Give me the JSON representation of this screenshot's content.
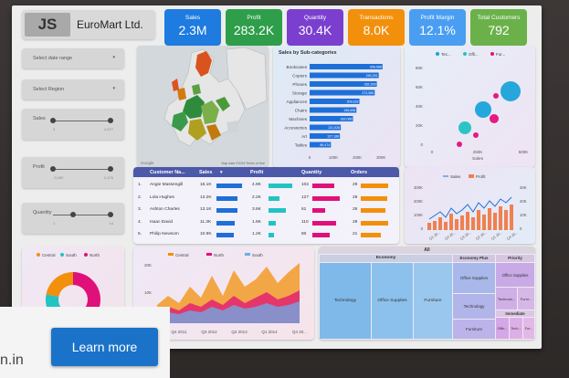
{
  "brand": {
    "logo_text": "JS",
    "name": "EuroMart Ltd."
  },
  "kpis": [
    {
      "title": "Sales",
      "value": "2.3M",
      "color": "#1e7be0"
    },
    {
      "title": "Profit",
      "value": "283.2K",
      "color": "#2e9e4a"
    },
    {
      "title": "Quantity",
      "value": "30.4K",
      "color": "#7b3fcf"
    },
    {
      "title": "Transactions",
      "value": "8.0K",
      "color": "#f2900c"
    },
    {
      "title": "Profit Margin",
      "value": "12.1%",
      "color": "#4a9ef2"
    },
    {
      "title": "Total Customers",
      "value": "792",
      "color": "#6bb14a"
    }
  ],
  "filters": {
    "date_range": "Select date range",
    "region": "Select Region",
    "sales": {
      "label": "Sales",
      "min": "3",
      "max": "4,677"
    },
    "profit": {
      "label": "Profit",
      "min": "-3,060",
      "max": "2,476"
    },
    "quantity": {
      "label": "Quantity",
      "min": "1",
      "max": "14"
    }
  },
  "map": {
    "attribution": "Google",
    "footer": "Map data ©2019 Terms of Use"
  },
  "subcat_chart": {
    "title": "Sales by Sub-categories",
    "ticks": [
      "0",
      "100K",
      "200K",
      "300K"
    ],
    "rows": [
      {
        "label": "Bookcases",
        "value": "306,088",
        "num": 306088
      },
      {
        "label": "Copiers",
        "value": "290,291",
        "num": 290291
      },
      {
        "label": "Phones",
        "value": "282,309",
        "num": 282309
      },
      {
        "label": "Storage",
        "value": "273,585",
        "num": 273585
      },
      {
        "label": "Appliances",
        "value": "209,333",
        "num": 209333
      },
      {
        "label": "Chairs",
        "value": "196,698",
        "num": 196698
      },
      {
        "label": "Machines",
        "value": "182,066",
        "num": 182066
      },
      {
        "label": "Accessories",
        "value": "131,028",
        "num": 131028
      },
      {
        "label": "Art",
        "value": "127,188",
        "num": 127188
      },
      {
        "label": "Tables",
        "value": "89,474",
        "num": 89474
      }
    ]
  },
  "bubble_chart": {
    "legend": [
      {
        "label": "Tec...",
        "color": "#1aa3d9"
      },
      {
        "label": "Offi...",
        "color": "#22c3c3"
      },
      {
        "label": "Fur...",
        "color": "#e0107a"
      }
    ],
    "y_ticks": [
      "80K",
      "60K",
      "40K",
      "20K",
      "0"
    ],
    "x_ticks": [
      "0",
      "250K",
      "500K"
    ],
    "x_label": "Sales"
  },
  "customer_table": {
    "headers": [
      "Customer Na...",
      "Sales",
      "Profit",
      "Quantity",
      "Orders"
    ],
    "sort_icon": "▾",
    "rows": [
      {
        "n": "1.",
        "name": "Angie Massengill",
        "sales": "16.1K",
        "profit": "4.9K",
        "qty": "102",
        "orders": "29"
      },
      {
        "n": "2.",
        "name": "Lola Hughes",
        "sales": "13.2K",
        "profit": "2.2K",
        "qty": "127",
        "orders": "28"
      },
      {
        "n": "3.",
        "name": "Ashton Charles",
        "sales": "13.1K",
        "profit": "3.6K",
        "qty": "61",
        "orders": "26"
      },
      {
        "n": "4.",
        "name": "Isaac David",
        "sales": "11.3K",
        "profit": "1.6K",
        "qty": "110",
        "orders": "29"
      },
      {
        "n": "5.",
        "name": "Philip Newsom",
        "sales": "10.9K",
        "profit": "1.2K",
        "qty": "80",
        "orders": "21"
      }
    ]
  },
  "combo_chart": {
    "legend": [
      "Sales",
      "Profit"
    ],
    "y_left": [
      "300K",
      "200K",
      "100K",
      "0"
    ],
    "y_right": [
      "30K",
      "20K",
      "10K",
      "0"
    ],
    "x_ticks": [
      "Q1 20...",
      "Q4 20...",
      "Q3 20...",
      "Q2 20...",
      "Q1 20...",
      "Q4 20..."
    ]
  },
  "donut": {
    "legend": [
      {
        "label": "Central",
        "color": "#f2900c"
      },
      {
        "label": "South",
        "color": "#22c3c3"
      },
      {
        "label": "North",
        "color": "#e0107a"
      }
    ]
  },
  "area_chart": {
    "legend": [
      {
        "label": "Central",
        "color": "#f2900c"
      },
      {
        "label": "North",
        "color": "#e0107a"
      },
      {
        "label": "South",
        "color": "#6aaee8"
      }
    ],
    "y_ticks": [
      "20K",
      "10K",
      "0"
    ],
    "x_ticks": [
      "Q4 2011",
      "Q3 2012",
      "Q2 2013",
      "Q1 2014",
      "Q4 20..."
    ]
  },
  "treemap": {
    "root": "All",
    "groups": [
      {
        "title": "Economy",
        "cells": [
          "Technology",
          "Office Supplies",
          "Furniture"
        ]
      },
      {
        "title": "Economy Plus",
        "cells": [
          "Office Supplies",
          "Technology",
          "Furniture"
        ]
      },
      {
        "title": "Priority",
        "cells": [
          "Office Supplies",
          "Technolo...",
          "Furni..."
        ]
      },
      {
        "title": "Immediate",
        "cells": [
          "Offic...",
          "Tech...",
          "Fur..."
        ]
      }
    ]
  },
  "overlay": {
    "button": "Learn more",
    "domain_fragment": "n.in"
  }
}
